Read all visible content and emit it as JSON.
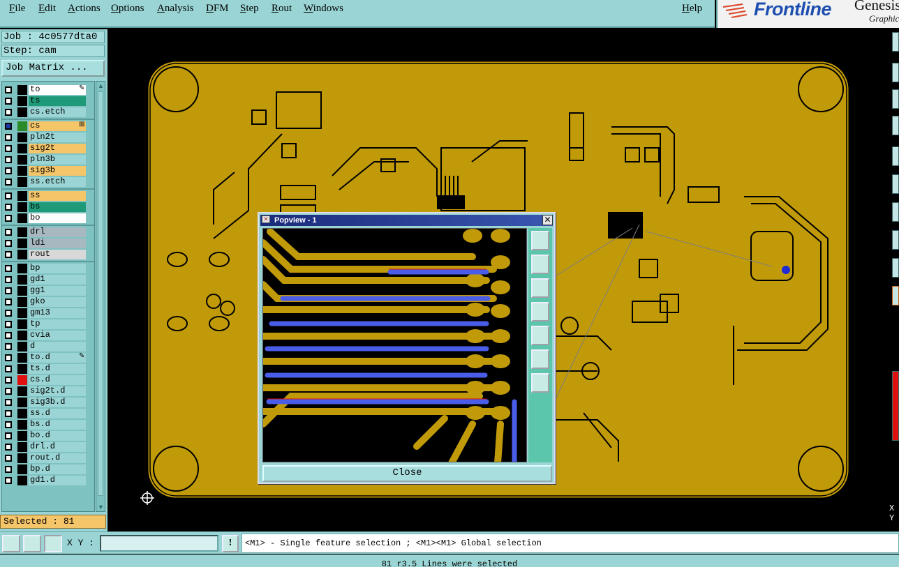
{
  "menu": {
    "file": "File",
    "edit": "Edit",
    "actions": "Actions",
    "options": "Options",
    "analysis": "Analysis",
    "dfm": "DFM",
    "step": "Step",
    "rout": "Rout",
    "windows": "Windows",
    "help": "Help"
  },
  "brand": {
    "logo": "Frontline",
    "product": "Genesis",
    "subtitle": "Graphic Edi"
  },
  "job": {
    "job_line": "Job : 4c0577dta0",
    "step_line": "Step: cam",
    "matrix_button": "Job Matrix ..."
  },
  "layers": [
    {
      "name": "to",
      "color": "#ffffff",
      "mark": "✎"
    },
    {
      "name": "ts",
      "color": "#1f9a78",
      "mark": ""
    },
    {
      "name": "cs.etch",
      "color": "#9ad4d4",
      "mark": ""
    },
    {
      "name": "cs",
      "color": "#f5c56a",
      "mark": "⊞",
      "selected": true
    },
    {
      "name": "pln2t",
      "color": "#9ad4d4",
      "mark": ""
    },
    {
      "name": "sig2t",
      "color": "#f5c56a",
      "mark": ""
    },
    {
      "name": "pln3b",
      "color": "#9ad4d4",
      "mark": ""
    },
    {
      "name": "sig3b",
      "color": "#f5c56a",
      "mark": ""
    },
    {
      "name": "ss.etch",
      "color": "#9ad4d4",
      "mark": ""
    },
    {
      "name": "ss",
      "color": "#f5c56a",
      "mark": ""
    },
    {
      "name": "bs",
      "color": "#1f9a78",
      "mark": ""
    },
    {
      "name": "bo",
      "color": "#ffffff",
      "mark": ""
    },
    {
      "name": "drl",
      "color": "#a8b8c0",
      "mark": ""
    },
    {
      "name": "ldi",
      "color": "#a8b8c0",
      "mark": ""
    },
    {
      "name": "rout",
      "color": "#d8d8d8",
      "mark": ""
    },
    {
      "name": "bp",
      "color": "#9ad4d4",
      "mark": ""
    },
    {
      "name": "gd1",
      "color": "#9ad4d4",
      "mark": ""
    },
    {
      "name": "gg1",
      "color": "#9ad4d4",
      "mark": ""
    },
    {
      "name": "gko",
      "color": "#9ad4d4",
      "mark": ""
    },
    {
      "name": "gm13",
      "color": "#9ad4d4",
      "mark": ""
    },
    {
      "name": "tp",
      "color": "#9ad4d4",
      "mark": ""
    },
    {
      "name": "cvia",
      "color": "#9ad4d4",
      "mark": ""
    },
    {
      "name": "d",
      "color": "#9ad4d4",
      "mark": ""
    },
    {
      "name": "to.d",
      "color": "#9ad4d4",
      "mark": "✎"
    },
    {
      "name": "ts.d",
      "color": "#9ad4d4",
      "mark": ""
    },
    {
      "name": "cs.d",
      "color": "#9ad4d4",
      "mark": "",
      "swatch": "#e01010"
    },
    {
      "name": "sig2t.d",
      "color": "#9ad4d4",
      "mark": ""
    },
    {
      "name": "sig3b.d",
      "color": "#9ad4d4",
      "mark": ""
    },
    {
      "name": "ss.d",
      "color": "#9ad4d4",
      "mark": ""
    },
    {
      "name": "bs.d",
      "color": "#9ad4d4",
      "mark": ""
    },
    {
      "name": "bo.d",
      "color": "#9ad4d4",
      "mark": ""
    },
    {
      "name": "drl.d",
      "color": "#9ad4d4",
      "mark": ""
    },
    {
      "name": "rout.d",
      "color": "#9ad4d4",
      "mark": ""
    },
    {
      "name": "bp.d",
      "color": "#9ad4d4",
      "mark": ""
    },
    {
      "name": "gd1.d",
      "color": "#9ad4d4",
      "mark": ""
    }
  ],
  "selected_text": "Selected : 81",
  "popview": {
    "title": "Popview - 1",
    "close_label": "Close"
  },
  "bottom": {
    "xy_label": "X Y :",
    "xy_value": "",
    "bang": "!",
    "hint": "<M1> - Single feature selection ; <M1><M1> Global selection"
  },
  "status": "81 r3.5 Lines were selected",
  "coords": {
    "x_label": "X",
    "y_label": "Y"
  },
  "colors": {
    "board": "#c19a0a",
    "trace_highlight": "#4a5de8",
    "accent_red": "#e01010"
  }
}
